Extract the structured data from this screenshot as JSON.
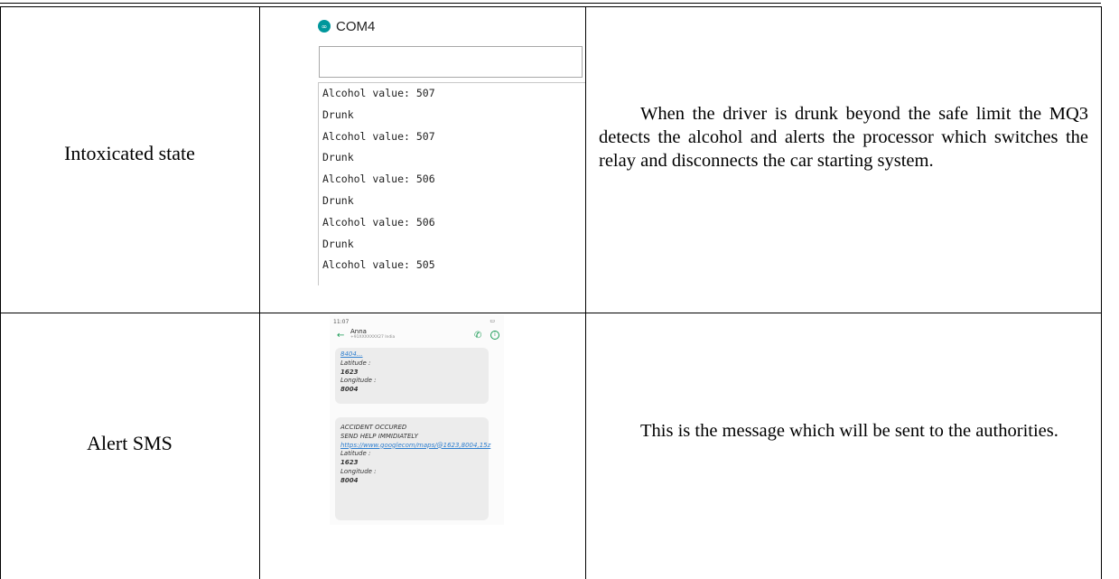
{
  "rows": [
    {
      "label": "Intoxicated state",
      "description": "When the driver is drunk beyond the safe limit the MQ3 detects the alcohol and alerts the processor which switches the relay and disconnects the car starting system."
    },
    {
      "label": "Alert SMS",
      "description": "This is the message which will be sent to the authorities."
    }
  ],
  "serial_monitor": {
    "title": "COM4",
    "input_value": "",
    "output_lines": [
      "Alcohol value: 507",
      "Drunk",
      "Alcohol value: 507",
      "Drunk",
      "Alcohol value: 506",
      "Drunk",
      "Alcohol value: 506",
      "Drunk",
      "Alcohol value: 505"
    ]
  },
  "sms": {
    "status_time": "11:07",
    "contact_name": "Anna",
    "contact_sub": "+91XXXXXXX27  India",
    "bubble1": {
      "top_fragment": "8404...",
      "lat_label": "Latitude :",
      "lat_value": "1623",
      "lon_label": "Longitude :",
      "lon_value": "8004"
    },
    "bubble2": {
      "line1": "ACCIDENT OCCURED",
      "line2": "SEND HELP IMMIDIATELY",
      "link": "https://www.googlecom/maps/@1623,8004,15z",
      "lat_label": "Latitude :",
      "lat_value": "1623",
      "lon_label": "Longitude :",
      "lon_value": "8004"
    }
  }
}
